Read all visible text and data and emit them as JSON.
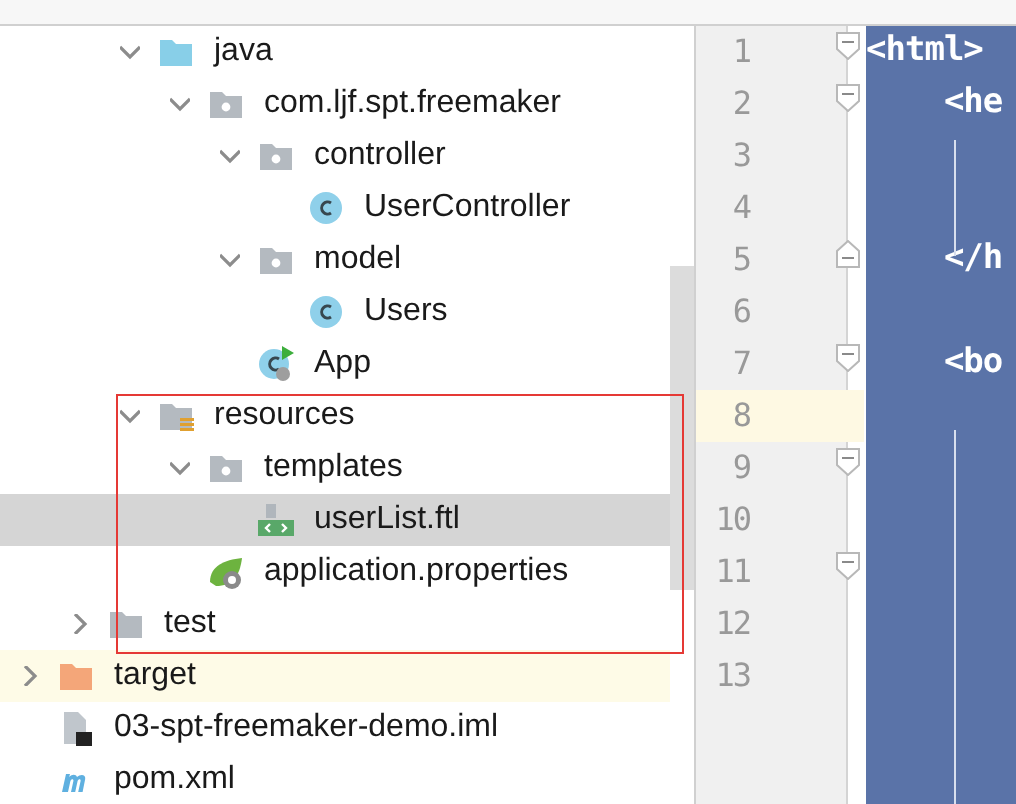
{
  "tree": [
    {
      "children": [
        {
          "children": [
            {
              "label": "java",
              "kind": "source-folder",
              "expanded": true,
              "children": [
                {
                  "label": "com.ljf.spt.freemaker",
                  "kind": "package",
                  "expanded": true,
                  "children": [
                    {
                      "label": "controller",
                      "kind": "package",
                      "expanded": true,
                      "children": [
                        {
                          "label": "UserController",
                          "kind": "class"
                        }
                      ]
                    },
                    {
                      "label": "model",
                      "kind": "package",
                      "expanded": true,
                      "children": [
                        {
                          "label": "Users",
                          "kind": "class"
                        }
                      ]
                    },
                    {
                      "label": "App",
                      "kind": "app-class"
                    }
                  ]
                }
              ]
            },
            {
              "label": "resources",
              "kind": "resources-folder",
              "expanded": true,
              "children": [
                {
                  "label": "templates",
                  "kind": "package",
                  "expanded": true,
                  "children": [
                    {
                      "label": "userList.ftl",
                      "kind": "template-file",
                      "selected": true
                    }
                  ]
                },
                {
                  "label": "application.properties",
                  "kind": "properties-file"
                }
              ]
            }
          ]
        },
        {
          "label": "test",
          "kind": "folder",
          "expanded": false
        }
      ]
    },
    {
      "label": "target",
      "kind": "excluded-folder",
      "expanded": false,
      "highlighted": true
    },
    {
      "label": "03-spt-freemaker-demo.iml",
      "kind": "module-file"
    },
    {
      "label": "pom.xml",
      "kind": "maven-file"
    }
  ],
  "editor": {
    "lines": [
      {
        "number": "1",
        "text": "<html>",
        "kind": "opener",
        "current": false
      },
      {
        "number": "2",
        "text": "    <he",
        "kind": "opener",
        "current": false
      },
      {
        "number": "3",
        "kind": "plain",
        "current": false
      },
      {
        "number": "4",
        "kind": "plain",
        "current": false
      },
      {
        "number": "5",
        "text": "    </h",
        "kind": "closer",
        "current": false
      },
      {
        "number": "6",
        "kind": "plain",
        "current": false
      },
      {
        "number": "7",
        "text": "    <bo",
        "kind": "opener",
        "current": false
      },
      {
        "number": "8",
        "kind": "plain",
        "current": true
      },
      {
        "number": "9",
        "kind": "opener",
        "current": false
      },
      {
        "number": "10",
        "kind": "plain",
        "current": false
      },
      {
        "number": "11",
        "kind": "opener",
        "current": false
      },
      {
        "number": "12",
        "kind": "plain",
        "current": false
      },
      {
        "number": "13",
        "kind": "plain",
        "current": false
      }
    ]
  }
}
